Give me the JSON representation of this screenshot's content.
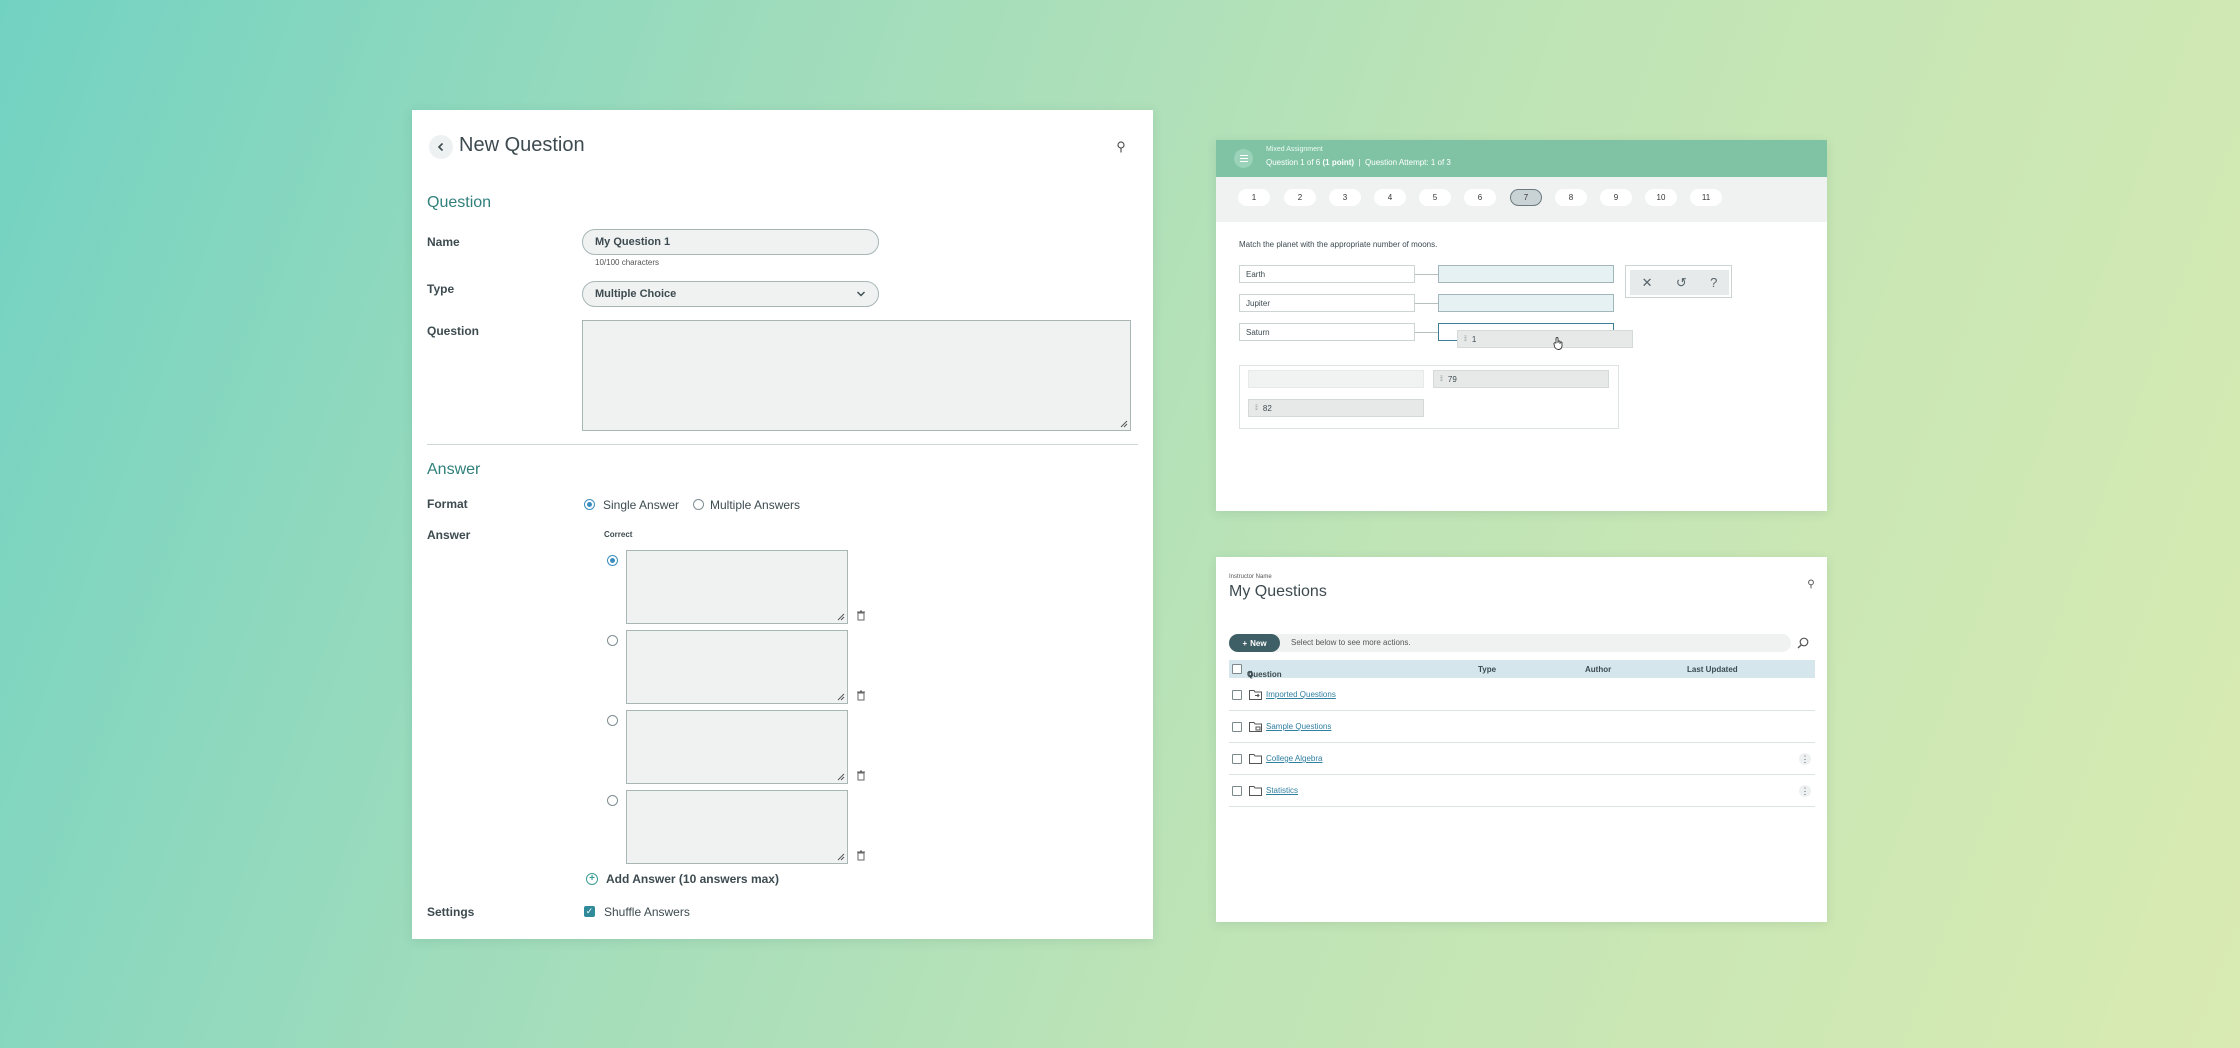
{
  "new_question": {
    "title": "New Question",
    "question_section": "Question",
    "name_label": "Name",
    "name_value": "My Question 1",
    "name_helper": "10/100 characters",
    "type_label": "Type",
    "type_value": "Multiple Choice",
    "question_label": "Question",
    "answer_section": "Answer",
    "format_label": "Format",
    "format_single": "Single Answer",
    "format_multiple": "Multiple Answers",
    "answer_label": "Answer",
    "correct_label": "Correct",
    "add_answer": "Add Answer (10 answers max)",
    "settings_label": "Settings",
    "shuffle_label": "Shuffle Answers"
  },
  "assignment": {
    "title": "Mixed Assignment",
    "subtitle_question": "Question 1 of 6",
    "subtitle_points": "(1 point)",
    "subtitle_sep": "|",
    "subtitle_attempt": "Question Attempt: 1 of 3",
    "question_numbers": [
      "1",
      "2",
      "3",
      "4",
      "5",
      "6",
      "7",
      "8",
      "9",
      "10",
      "11"
    ],
    "current_question": "7",
    "prompt": "Match the planet with the appropriate number of moons.",
    "planets": [
      "Earth",
      "Jupiter",
      "Saturn"
    ],
    "dragging_chip": "1",
    "pool_chips": [
      "79",
      "82"
    ]
  },
  "my_questions": {
    "instructor": "Instructor Name",
    "title": "My Questions",
    "new_button": "New",
    "actions_hint": "Select below to see more actions.",
    "columns": [
      "Question",
      "Type",
      "Author",
      "Last Updated"
    ],
    "rows": [
      "Imported Questions",
      "Sample Questions",
      "College Algebra",
      "Statistics"
    ]
  },
  "colors": {
    "accent": "#2f7f7b",
    "header_bar": "#7fc3a4",
    "link": "#2f7fa0",
    "radio_on": "#3b8ec0"
  }
}
